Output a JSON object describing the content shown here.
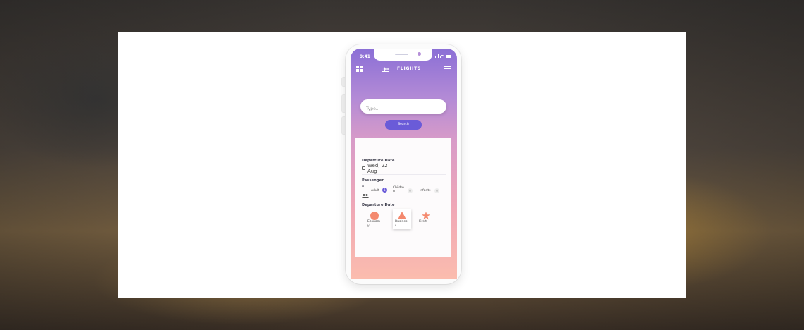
{
  "phone": {
    "status_time": "9:41",
    "title": "FLIGHTS",
    "icons": {
      "menu": "grid-icon",
      "plane": "plane-icon",
      "filter": "sliders-icon"
    }
  },
  "search": {
    "placeholder": "Type...",
    "button_label": "Search"
  },
  "card": {
    "departure_label": "Departure Date",
    "departure_date": "Wed, 22 Aug",
    "passengers_label": "Passenger s",
    "passengers": [
      {
        "label": "Adult",
        "count": "1"
      },
      {
        "label": "Childre n",
        "count": "0"
      },
      {
        "label": "Infants",
        "count": "0"
      }
    ],
    "class_label": "Departure Date",
    "classes": [
      {
        "label": "Econom y",
        "icon": "circle-icon",
        "selected": false
      },
      {
        "label": "Busines s",
        "icon": "triangle-icon",
        "selected": true
      },
      {
        "label": "Firs t",
        "icon": "star-icon",
        "selected": false
      }
    ]
  },
  "colors": {
    "accent": "#6a5bd8",
    "class_icon": "#f4896e"
  }
}
